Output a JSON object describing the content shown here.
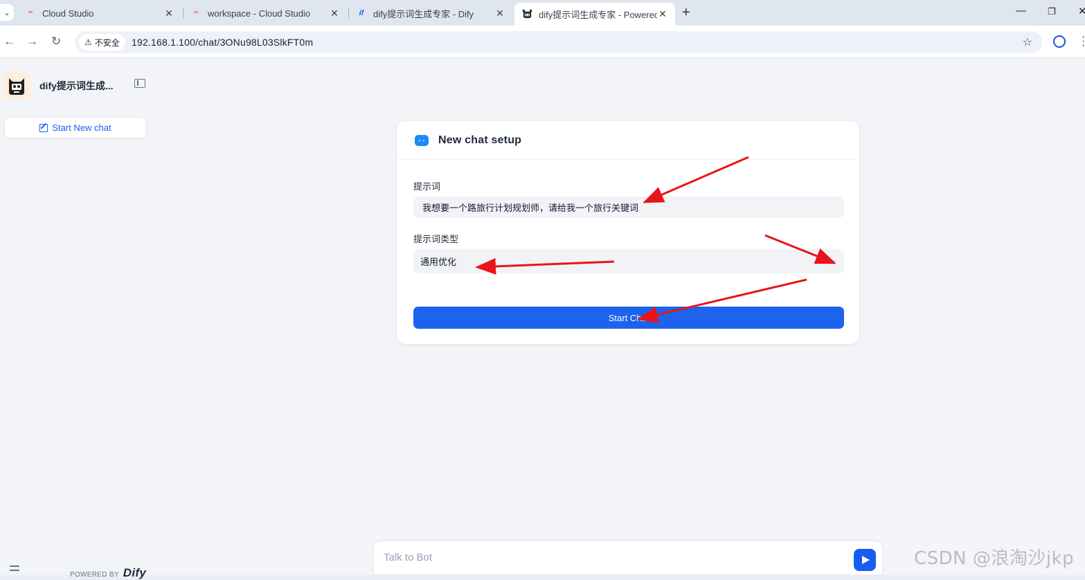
{
  "browser": {
    "tabs": [
      {
        "title": "Cloud Studio",
        "favicon": "cloud-studio-icon"
      },
      {
        "title": "workspace - Cloud Studio",
        "favicon": "cloud-studio-icon"
      },
      {
        "title": "dify提示词生成专家 - Dify",
        "favicon": "dify-icon"
      },
      {
        "title": "dify提示词生成专家 - Powered",
        "favicon": "robot-icon",
        "active": true
      }
    ],
    "security_chip": "不安全",
    "url": "192.168.1.100/chat/3ONu98L03SlkFT0m"
  },
  "sidebar": {
    "app_name": "dify提示词生成...",
    "new_chat_label": "Start New chat",
    "powered_by": "POWERED BY",
    "brand": "Dify"
  },
  "setup": {
    "title": "New chat setup",
    "fields": [
      {
        "label": "提示词",
        "value": "我想要一个路旅行计划规划师，请给我一个旅行关键词"
      },
      {
        "label": "提示词类型",
        "value": "通用优化"
      }
    ],
    "start_label": "Start Chat"
  },
  "chat": {
    "placeholder": "Talk to Bot"
  },
  "watermark": "CSDN @浪淘沙jkp",
  "colors": {
    "accent": "#1d63ed",
    "annotation_arrow": "#e8141b"
  }
}
